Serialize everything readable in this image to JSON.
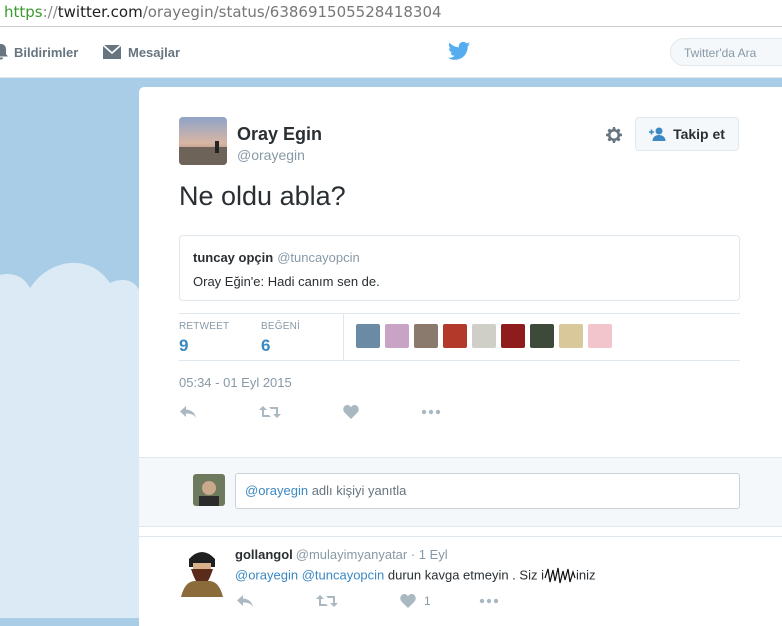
{
  "browser": {
    "url_scheme": "https",
    "url_sep": "://",
    "url_host": "twitter.com",
    "url_path": "/orayegin/status/638691505528418304"
  },
  "nav": {
    "notifications_label": "Bildirimler",
    "messages_label": "Mesajlar",
    "search_placeholder": "Twitter'da Ara"
  },
  "tweet": {
    "author_name": "Oray Egin",
    "author_handle": "@orayegin",
    "follow_label": "Takip et",
    "text": "Ne oldu abla?",
    "quote": {
      "name": "tuncay opçin",
      "handle": "@tuncayopcin",
      "text": "Oray Eğin'e: Hadi canım sen de."
    },
    "stats": {
      "retweet_label": "RETWEET",
      "retweet_count": "9",
      "like_label": "BEĞENİ",
      "like_count": "6"
    },
    "timestamp": "05:34 - 01 Eyl 2015"
  },
  "reply_box": {
    "mention": "@orayegin",
    "placeholder_rest": " adlı kişiyi yanıtla"
  },
  "reply": {
    "name": "gollangol",
    "meta": "@mulayimyanyatar · 1 Eyl",
    "mention1": "@orayegin",
    "mention2": "@tuncayopcin",
    "text_mid": " durun kavga etmeyin . Siz i",
    "text_end": "iniz",
    "like_count": "1"
  },
  "colors": {
    "accent": "#3b88c3",
    "bird": "#55acee",
    "background": "#a9cde6"
  }
}
